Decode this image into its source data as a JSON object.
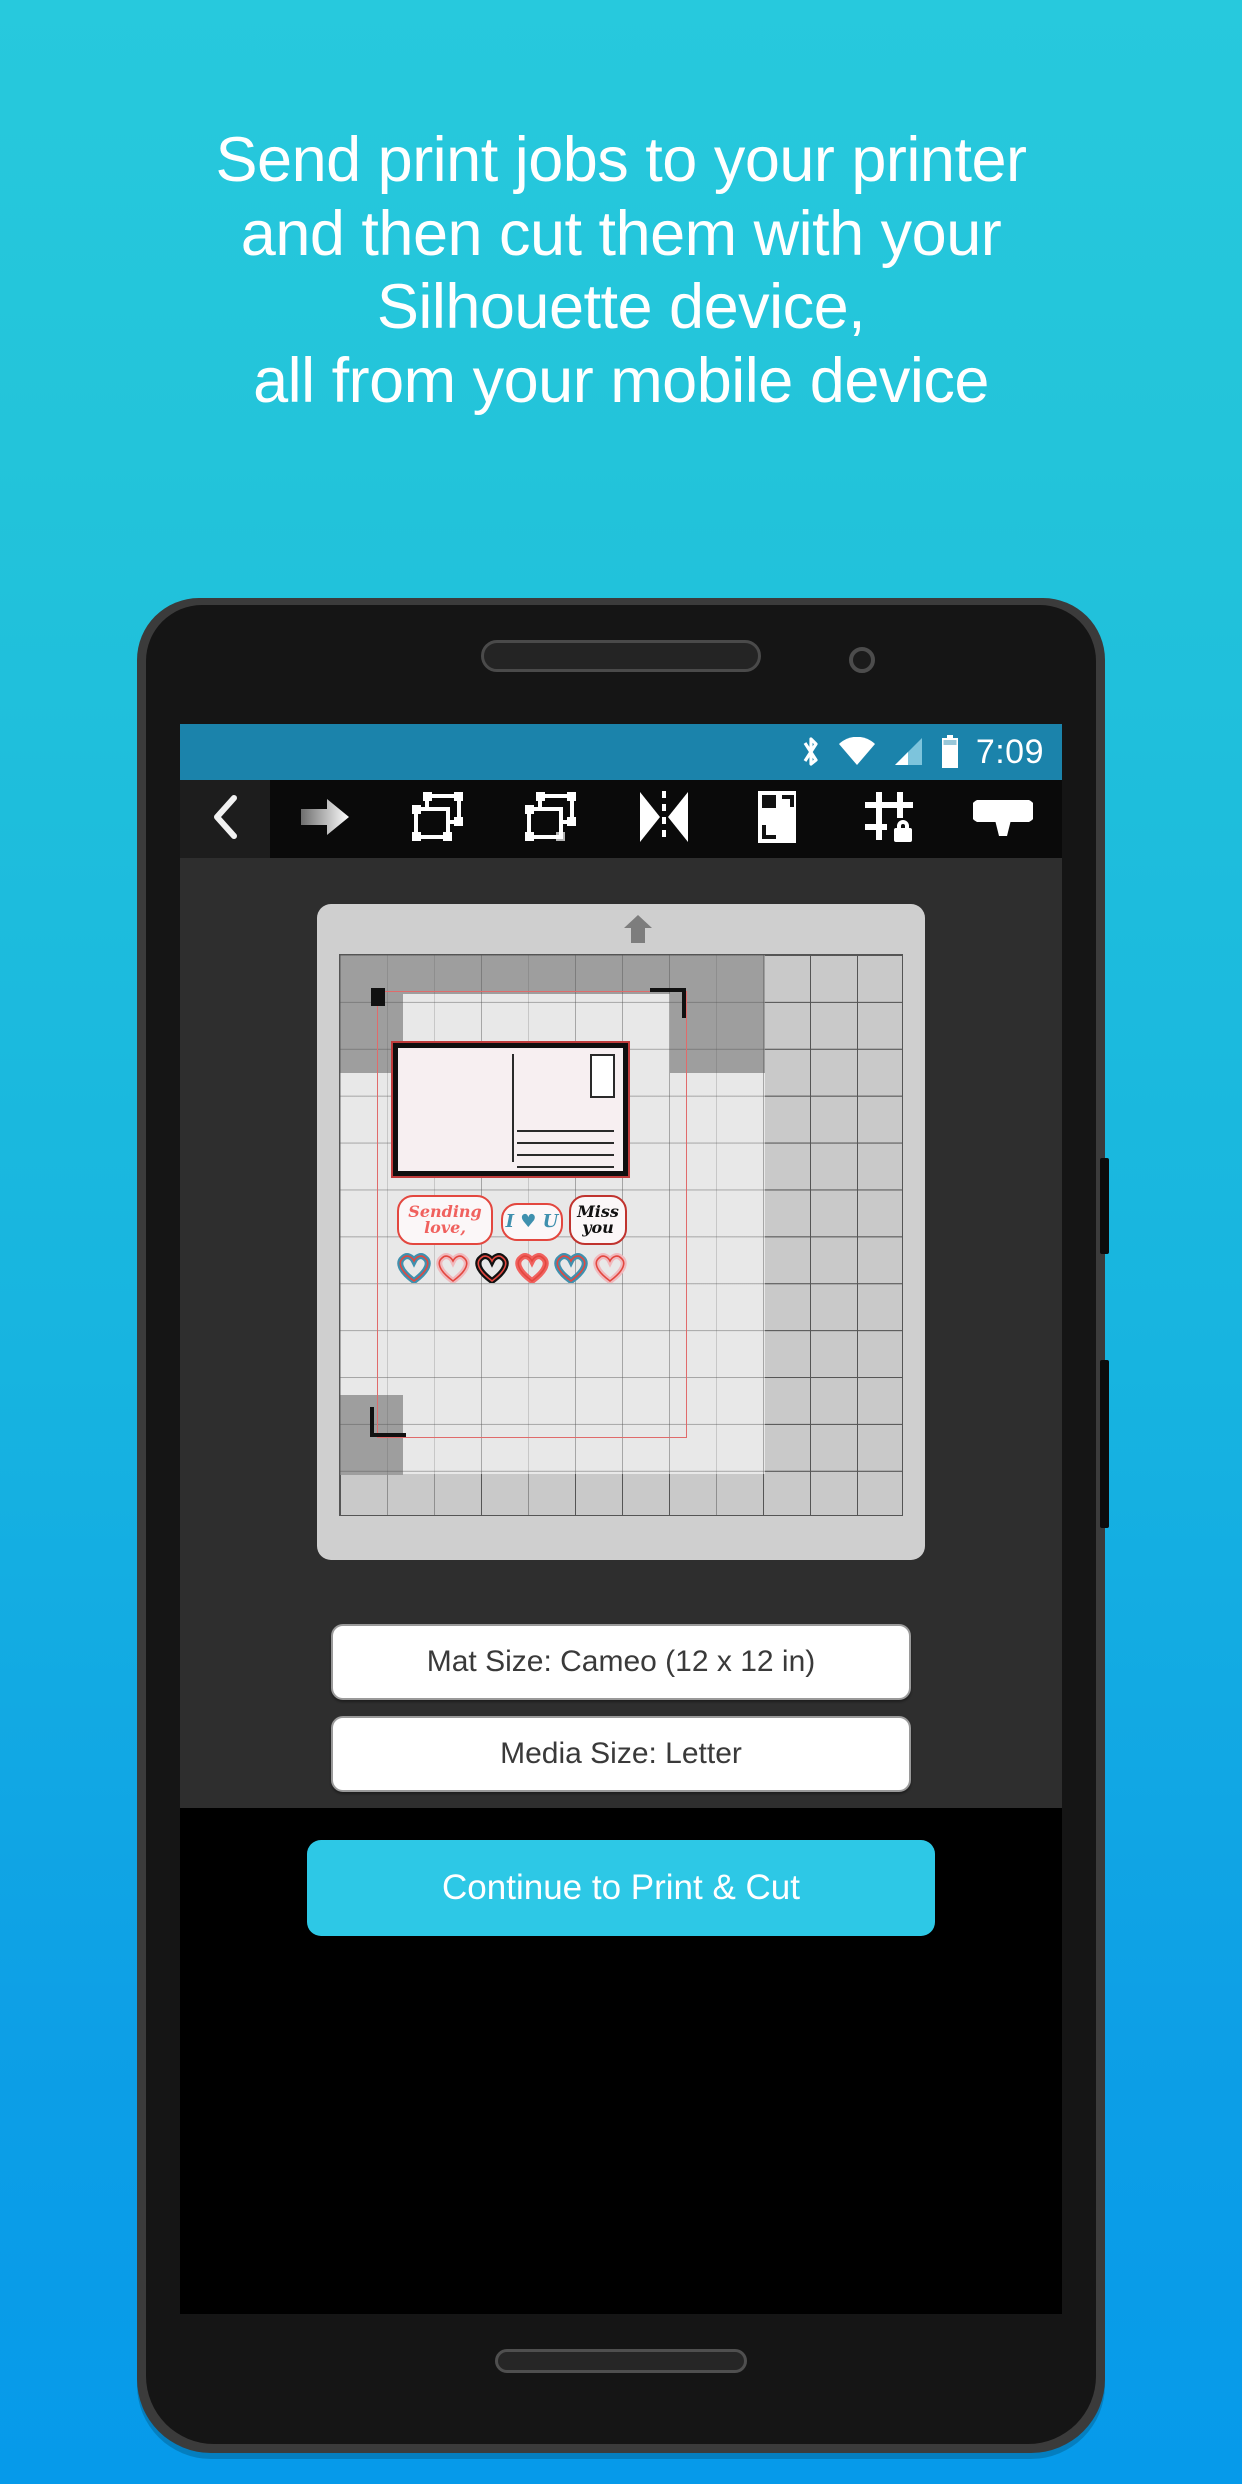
{
  "background": {
    "color_top": "#27c9dd",
    "color_bottom": "#069aea"
  },
  "headline": {
    "text": "Send print jobs to your printer\nand then cut them with your\nSilhouette device,\nall from your mobile device",
    "color": "#ffffff"
  },
  "phone": {
    "status_bar": {
      "time": "7:09",
      "background": "#1b83ab",
      "icons": [
        "bluetooth-icon",
        "wifi-icon",
        "cellular-signal-icon",
        "battery-icon"
      ]
    },
    "toolbar": {
      "background": "#0a0a0a",
      "back_icon": "chevron-left-icon",
      "items": [
        {
          "name": "send-arrow-icon",
          "label": "Send"
        },
        {
          "name": "bring-to-front-icon",
          "label": "Bring to Front"
        },
        {
          "name": "send-to-back-icon",
          "label": "Send to Back"
        },
        {
          "name": "mirror-flip-icon",
          "label": "Mirror"
        },
        {
          "name": "registration-marks-icon",
          "label": "Registration Marks"
        },
        {
          "name": "grid-snap-lock-icon",
          "label": "Grid & Snap"
        },
        {
          "name": "cut-settings-icon",
          "label": "Cut Settings"
        }
      ]
    },
    "workspace": {
      "mat": {
        "name": "cutting-mat",
        "feed_arrow_icon": "mat-feed-arrow-icon",
        "grid_columns": 12,
        "grid_rows": 12,
        "registration_border_color": "#e06b6b",
        "design": {
          "postcard": {
            "name": "postcard-design",
            "border_color": "#0f0f0f",
            "face_color": "#f7eff1",
            "address_lines": 4,
            "has_stamp_box": true,
            "has_divider": true
          },
          "stickers": [
            {
              "name": "sticker-sending-love",
              "text": "Sending\nlove,",
              "color": "#f0615e",
              "outline": "#e3473f"
            },
            {
              "name": "sticker-i-love-u",
              "text": "I ♥ U",
              "color": "#3f90ae",
              "outline": "#e3473f"
            },
            {
              "name": "sticker-miss-you",
              "text": "Miss\nyou",
              "color": "#111111",
              "outline": "#c0332e"
            }
          ],
          "hearts": [
            {
              "name": "heart-sticker",
              "color": "#3f90ae"
            },
            {
              "name": "heart-sticker",
              "color": "#f0b9bd"
            },
            {
              "name": "heart-sticker",
              "color": "#111111"
            },
            {
              "name": "heart-sticker",
              "color": "#f0615e"
            },
            {
              "name": "heart-sticker",
              "color": "#3f90ae"
            },
            {
              "name": "heart-sticker",
              "color": "#f0b9bd"
            }
          ]
        }
      }
    },
    "options": {
      "mat_size_label": "Mat Size: Cameo (12 x 12 in)",
      "media_size_label": "Media Size: Letter"
    },
    "cta": {
      "label": "Continue to Print & Cut",
      "color": "#2dc8e6",
      "text_color": "#ffffff"
    }
  }
}
